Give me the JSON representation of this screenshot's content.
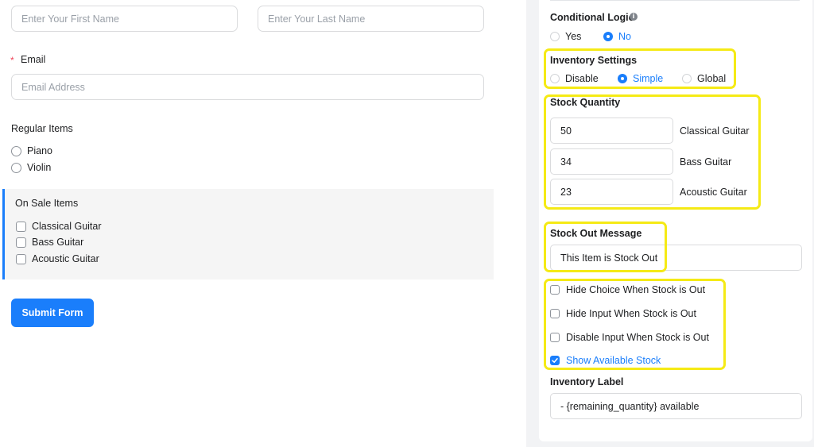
{
  "form": {
    "first_name_placeholder": "Enter Your First Name",
    "last_name_placeholder": "Enter Your Last Name",
    "email_required_mark": "*",
    "email_label": "Email",
    "email_placeholder": "Email Address",
    "regular_items_label": "Regular Items",
    "regular_items": [
      "Piano",
      "Violin"
    ],
    "on_sale_label": "On Sale Items",
    "on_sale_items": [
      "Classical Guitar",
      "Bass Guitar",
      "Acoustic Guitar"
    ],
    "submit_label": "Submit Form"
  },
  "settings": {
    "conditional_logic": {
      "label": "Conditional Logic",
      "info_icon": "info-icon",
      "options": [
        "Yes",
        "No"
      ],
      "selected": "No"
    },
    "inventory": {
      "label": "Inventory Settings",
      "options": [
        "Disable",
        "Simple",
        "Global"
      ],
      "selected": "Simple"
    },
    "stock_quantity": {
      "label": "Stock Quantity",
      "items": [
        {
          "value": "50",
          "name": "Classical Guitar"
        },
        {
          "value": "34",
          "name": "Bass Guitar"
        },
        {
          "value": "23",
          "name": "Acoustic Guitar"
        }
      ]
    },
    "stock_out": {
      "label": "Stock Out Message",
      "value": "This Item is Stock Out"
    },
    "options": [
      {
        "label": "Hide Choice When Stock is Out",
        "checked": false
      },
      {
        "label": "Hide Input When Stock is Out",
        "checked": false
      },
      {
        "label": "Disable Input When Stock is Out",
        "checked": false
      },
      {
        "label": "Show Available Stock",
        "checked": true
      }
    ],
    "inventory_label": {
      "label": "Inventory Label",
      "value": "- {remaining_quantity} available"
    }
  },
  "colors": {
    "accent": "#1a7efb",
    "highlight": "#f5ea15",
    "required": "#f0465a"
  }
}
